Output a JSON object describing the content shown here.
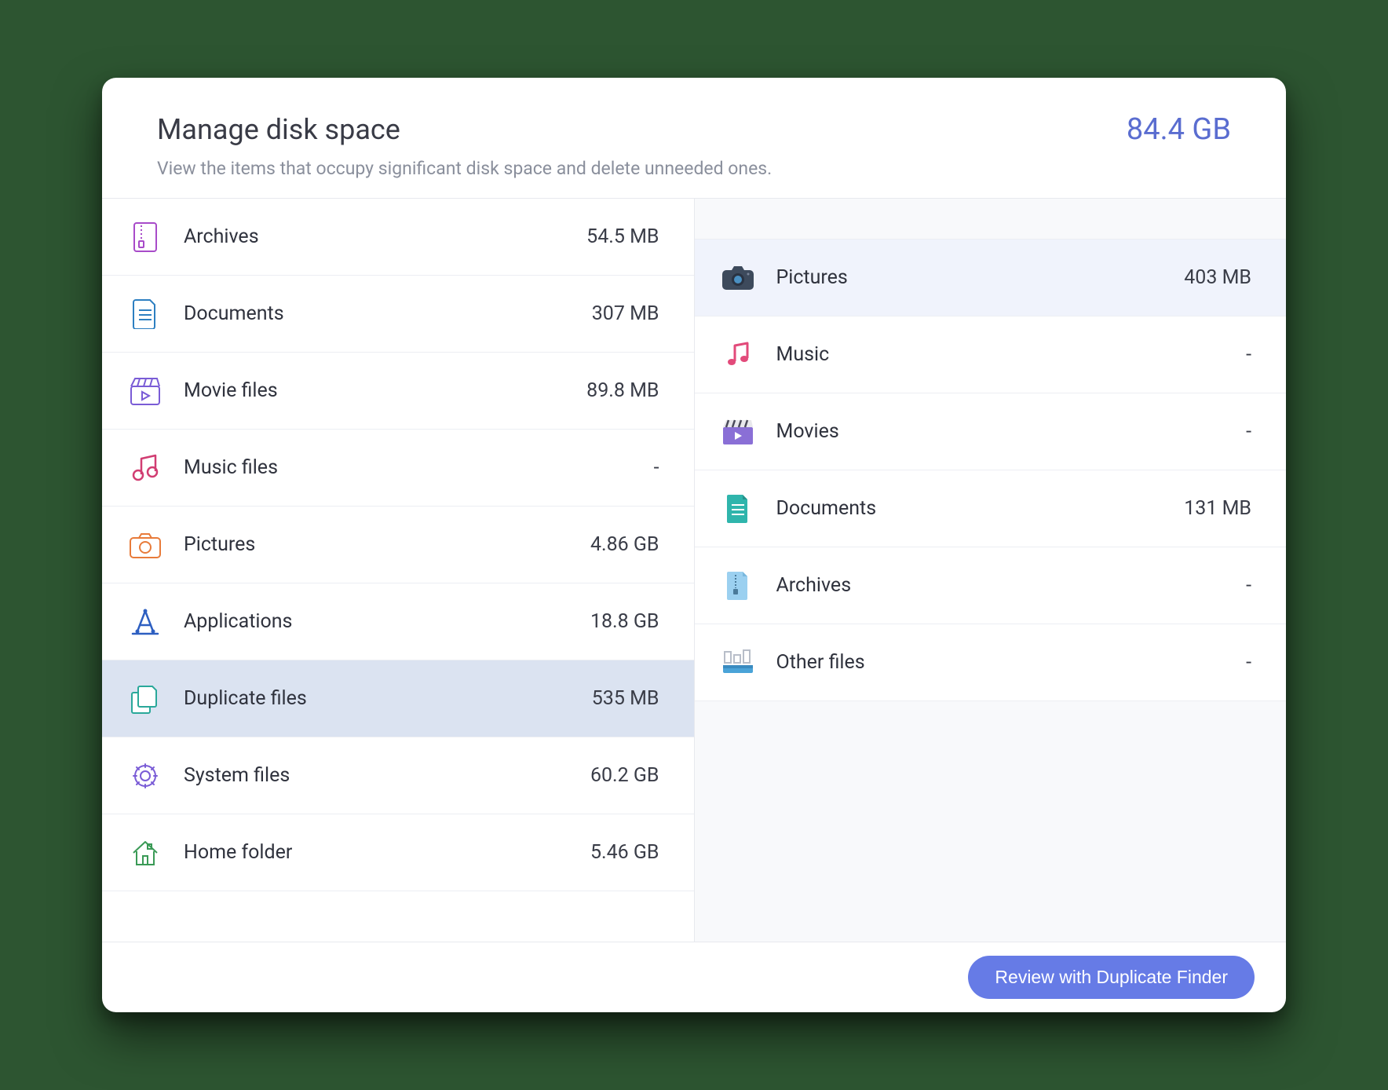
{
  "header": {
    "title": "Manage disk space",
    "total": "84.4 GB",
    "subtitle": "View the items that occupy significant disk space and delete unneeded ones."
  },
  "left": {
    "items": [
      {
        "label": "Archives",
        "size": "54.5 MB",
        "icon": "archive-icon",
        "selected": false
      },
      {
        "label": "Documents",
        "size": "307 MB",
        "icon": "document-icon",
        "selected": false
      },
      {
        "label": "Movie files",
        "size": "89.8 MB",
        "icon": "movie-icon",
        "selected": false
      },
      {
        "label": "Music files",
        "size": "-",
        "icon": "music-icon",
        "selected": false
      },
      {
        "label": "Pictures",
        "size": "4.86 GB",
        "icon": "picture-icon",
        "selected": false
      },
      {
        "label": "Applications",
        "size": "18.8 GB",
        "icon": "app-icon",
        "selected": false
      },
      {
        "label": "Duplicate files",
        "size": "535 MB",
        "icon": "duplicate-icon",
        "selected": true
      },
      {
        "label": "System files",
        "size": "60.2 GB",
        "icon": "gear-icon",
        "selected": false
      },
      {
        "label": "Home folder",
        "size": "5.46 GB",
        "icon": "home-icon",
        "selected": false
      }
    ]
  },
  "right": {
    "items": [
      {
        "label": "Pictures",
        "size": "403 MB",
        "icon": "camera-icon",
        "selected": true
      },
      {
        "label": "Music",
        "size": "-",
        "icon": "music-note-icon",
        "selected": false
      },
      {
        "label": "Movies",
        "size": "-",
        "icon": "clapper-icon",
        "selected": false
      },
      {
        "label": "Documents",
        "size": "131 MB",
        "icon": "doc-solid-icon",
        "selected": false
      },
      {
        "label": "Archives",
        "size": "-",
        "icon": "zip-icon",
        "selected": false
      },
      {
        "label": "Other files",
        "size": "-",
        "icon": "other-files-icon",
        "selected": false
      }
    ]
  },
  "footer": {
    "button": "Review with Duplicate Finder"
  }
}
